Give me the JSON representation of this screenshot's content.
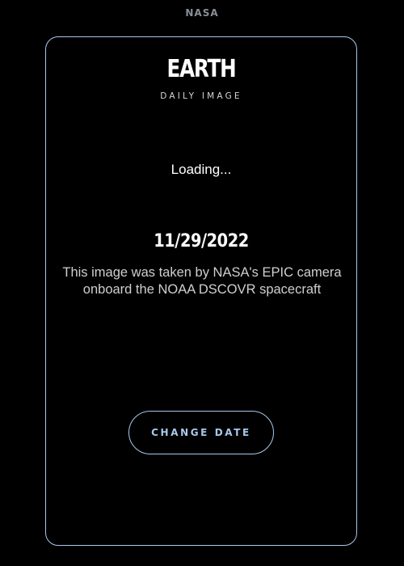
{
  "header": {
    "logo_text": "NASA"
  },
  "card": {
    "title": "EARTH",
    "subtitle": "DAILY IMAGE",
    "loading_text": "Loading...",
    "date": "11/29/2022",
    "description": "This image was taken by NASA's EPIC camera onboard the NOAA DSCOVR spacecraft",
    "change_date_label": "CHANGE DATE"
  },
  "colors": {
    "background": "#000000",
    "accent": "#a9c8ec",
    "text": "#ffffff",
    "muted_text": "#cfcfcf",
    "logo": "#8a8f96"
  }
}
